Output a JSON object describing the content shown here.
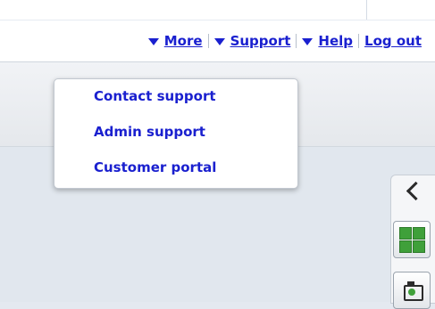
{
  "nav": {
    "more_label": "More",
    "support_label": "Support",
    "help_label": "Help",
    "logout_label": "Log out"
  },
  "support_menu": {
    "items": [
      {
        "label": "Contact support"
      },
      {
        "label": "Admin support"
      },
      {
        "label": "Customer portal"
      }
    ]
  },
  "side_rail": {
    "icons": [
      "chevron-left-icon",
      "grid-icon",
      "camera-icon"
    ]
  },
  "colors": {
    "link": "#1a20cf",
    "icon_green": "#3fa03a"
  }
}
